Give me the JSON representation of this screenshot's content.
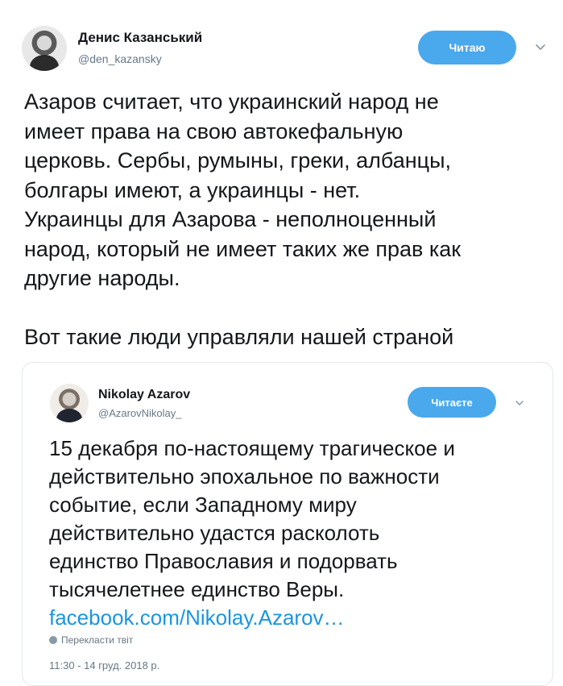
{
  "author": {
    "name": "Денис Казанський",
    "handle": "@den_kazansky",
    "follow_label": "Читаю"
  },
  "tweet": {
    "paragraphs": [
      "Азаров считает, что украинский народ не\nимеет права на свою автокефальную\nцерковь. Сербы, румыны, греки, албанцы,\nболгары имеют, а украинцы - нет.\nУкраинцы для Азарова - неполноценный\nнарод, который не имеет таких же прав как\nдругие народы.",
      "Вот такие люди управляли нашей страной"
    ]
  },
  "quoted": {
    "name": "Nikolay Azarov",
    "handle": "@AzarovNikolay_",
    "follow_label": "Читаєте",
    "text": "15 декабря по-настоящему трагическое и\nдействительно эпохальное по важности\nсобытие, если Западному миру\nдействительно удастся расколоть\nединство Православия и подорвать\nтысячелетнее единство Веры.",
    "link": "facebook.com/Nikolay.Azarov…",
    "translate_label": "Перекласти твіт",
    "timestamp": "11:30 - 14 груд. 2018 р."
  },
  "colors": {
    "accent": "#4aa8ec",
    "link": "#1b95e0",
    "secondary_text": "#657786",
    "border": "#e1e8ed"
  },
  "icons": {
    "menu": "chevron-down-icon",
    "translate": "globe-icon"
  }
}
